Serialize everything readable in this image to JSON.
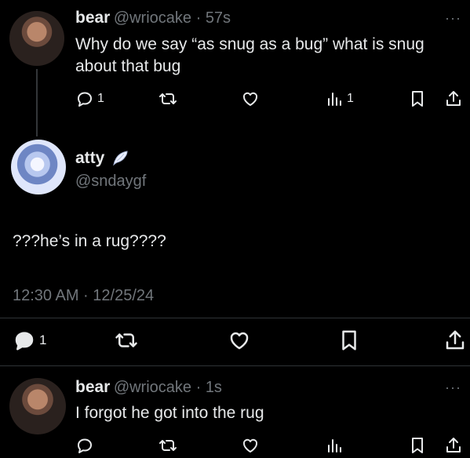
{
  "tweet1": {
    "name": "bear",
    "handle": "@wriocake",
    "time": "57s",
    "text": "Why do we say “as snug as a bug” what is snug about that bug",
    "replies": "1",
    "views": "1"
  },
  "main": {
    "name": "atty",
    "handle": "@sndaygf",
    "text": "???he’s in a rug????",
    "timestamp": "12:30 AM · 12/25/24",
    "replies": "1"
  },
  "tweet2": {
    "name": "bear",
    "handle": "@wriocake",
    "time": "1s",
    "text": "I forgot he got into the rug"
  },
  "colors": {
    "background": "#000000",
    "text": "#e7e9ea",
    "muted": "#71767b",
    "thread_line": "#333639"
  },
  "icons": [
    "reply-icon",
    "retweet-icon",
    "like-icon",
    "views-icon",
    "bookmark-icon",
    "share-icon",
    "more-icon",
    "angel-wing-icon"
  ]
}
